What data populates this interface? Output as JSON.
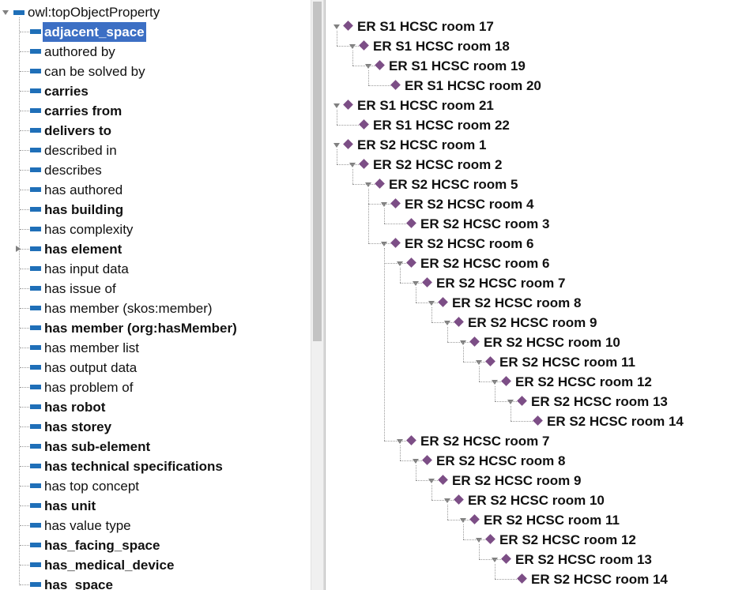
{
  "property_tree": {
    "root": "owl:topObjectProperty",
    "items": [
      {
        "label": "adjacent_space",
        "bold": true,
        "selected": true,
        "expandable": false
      },
      {
        "label": "authored by",
        "bold": false,
        "selected": false,
        "expandable": false
      },
      {
        "label": "can be solved by",
        "bold": false,
        "selected": false,
        "expandable": false
      },
      {
        "label": "carries",
        "bold": true,
        "selected": false,
        "expandable": false
      },
      {
        "label": "carries from",
        "bold": true,
        "selected": false,
        "expandable": false
      },
      {
        "label": "delivers to",
        "bold": true,
        "selected": false,
        "expandable": false
      },
      {
        "label": "described in",
        "bold": false,
        "selected": false,
        "expandable": false
      },
      {
        "label": "describes",
        "bold": false,
        "selected": false,
        "expandable": false
      },
      {
        "label": "has authored",
        "bold": false,
        "selected": false,
        "expandable": false
      },
      {
        "label": "has building",
        "bold": true,
        "selected": false,
        "expandable": false
      },
      {
        "label": "has complexity",
        "bold": false,
        "selected": false,
        "expandable": false
      },
      {
        "label": "has element",
        "bold": true,
        "selected": false,
        "expandable": true
      },
      {
        "label": "has input data",
        "bold": false,
        "selected": false,
        "expandable": false
      },
      {
        "label": "has issue of",
        "bold": false,
        "selected": false,
        "expandable": false
      },
      {
        "label": "has member (skos:member)",
        "bold": false,
        "selected": false,
        "expandable": false
      },
      {
        "label": "has member (org:hasMember)",
        "bold": true,
        "selected": false,
        "expandable": false
      },
      {
        "label": "has member list",
        "bold": false,
        "selected": false,
        "expandable": false
      },
      {
        "label": "has output data",
        "bold": false,
        "selected": false,
        "expandable": false
      },
      {
        "label": "has problem of",
        "bold": false,
        "selected": false,
        "expandable": false
      },
      {
        "label": "has robot",
        "bold": true,
        "selected": false,
        "expandable": false
      },
      {
        "label": "has storey",
        "bold": true,
        "selected": false,
        "expandable": false
      },
      {
        "label": "has sub-element",
        "bold": true,
        "selected": false,
        "expandable": false
      },
      {
        "label": "has technical specifications",
        "bold": true,
        "selected": false,
        "expandable": false
      },
      {
        "label": "has top concept",
        "bold": false,
        "selected": false,
        "expandable": false
      },
      {
        "label": "has unit",
        "bold": true,
        "selected": false,
        "expandable": false
      },
      {
        "label": "has value type",
        "bold": false,
        "selected": false,
        "expandable": false
      },
      {
        "label": "has_facing_space",
        "bold": true,
        "selected": false,
        "expandable": false
      },
      {
        "label": "has_medical_device",
        "bold": true,
        "selected": false,
        "expandable": false
      },
      {
        "label": "has_space",
        "bold": true,
        "selected": false,
        "expandable": false
      }
    ]
  },
  "individual_tree": {
    "nodes": [
      {
        "label": "ER S1 HCSC room 17",
        "depth": 0,
        "expanded": true
      },
      {
        "label": "ER S1 HCSC room 18",
        "depth": 1,
        "expanded": true
      },
      {
        "label": "ER S1 HCSC room 19",
        "depth": 2,
        "expanded": true
      },
      {
        "label": "ER S1 HCSC room 20",
        "depth": 3,
        "expanded": false
      },
      {
        "label": "ER S1 HCSC room 21",
        "depth": 0,
        "expanded": true
      },
      {
        "label": "ER S1 HCSC room 22",
        "depth": 1,
        "expanded": false
      },
      {
        "label": "ER S2 HCSC room 1",
        "depth": 0,
        "expanded": true
      },
      {
        "label": "ER S2 HCSC room 2",
        "depth": 1,
        "expanded": true
      },
      {
        "label": "ER S2 HCSC room 5",
        "depth": 2,
        "expanded": true
      },
      {
        "label": "ER S2 HCSC room 4",
        "depth": 3,
        "expanded": true
      },
      {
        "label": "ER S2 HCSC room 3",
        "depth": 4,
        "expanded": false
      },
      {
        "label": "ER S2 HCSC room 6",
        "depth": 3,
        "expanded": true
      },
      {
        "label": "ER S2 HCSC room 6",
        "depth": 4,
        "expanded": true
      },
      {
        "label": "ER S2 HCSC room 7",
        "depth": 5,
        "expanded": true
      },
      {
        "label": "ER S2 HCSC room 8",
        "depth": 6,
        "expanded": true
      },
      {
        "label": "ER S2 HCSC room 9",
        "depth": 7,
        "expanded": true
      },
      {
        "label": "ER S2 HCSC room 10",
        "depth": 8,
        "expanded": true
      },
      {
        "label": "ER S2 HCSC room 11",
        "depth": 9,
        "expanded": true
      },
      {
        "label": "ER S2 HCSC room 12",
        "depth": 10,
        "expanded": true
      },
      {
        "label": "ER S2 HCSC room 13",
        "depth": 11,
        "expanded": true
      },
      {
        "label": "ER S2 HCSC room 14",
        "depth": 12,
        "expanded": false
      },
      {
        "label": "ER S2 HCSC room 7",
        "depth": 4,
        "expanded": true
      },
      {
        "label": "ER S2 HCSC room 8",
        "depth": 5,
        "expanded": true
      },
      {
        "label": "ER S2 HCSC room 9",
        "depth": 6,
        "expanded": true
      },
      {
        "label": "ER S2 HCSC room 10",
        "depth": 7,
        "expanded": true
      },
      {
        "label": "ER S2 HCSC room 11",
        "depth": 8,
        "expanded": true
      },
      {
        "label": "ER S2 HCSC room 12",
        "depth": 9,
        "expanded": true
      },
      {
        "label": "ER S2 HCSC room 13",
        "depth": 10,
        "expanded": true
      },
      {
        "label": "ER S2 HCSC room 14",
        "depth": 11,
        "expanded": false
      }
    ]
  },
  "colors": {
    "property_icon": "#1f6fb8",
    "individual_icon": "#7c4e86",
    "selection": "#3c6fc4"
  },
  "icons": {
    "property": "object-property-icon",
    "individual": "individual-diamond-icon",
    "expanded": "expand-arrow-down-icon",
    "collapsed": "expand-arrow-right-icon"
  }
}
